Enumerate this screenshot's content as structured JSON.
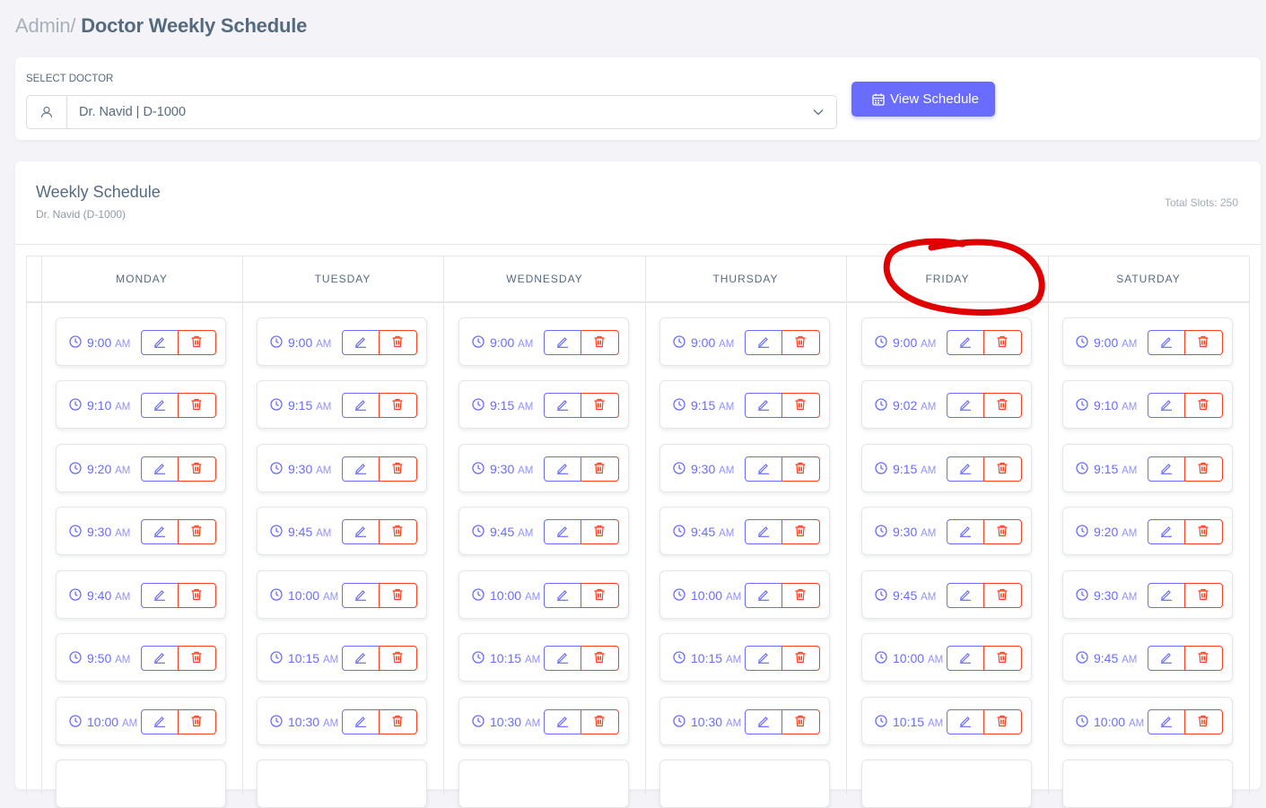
{
  "breadcrumb": {
    "parent": "Admin/",
    "current": "Doctor Weekly Schedule"
  },
  "selector": {
    "label": "SELECT DOCTOR",
    "selected_value": "Dr. Navid | D-1000",
    "icon": "user-icon",
    "button_label": "View Schedule",
    "button_icon": "calendar-icon"
  },
  "schedule": {
    "title": "Weekly Schedule",
    "subtitle": "Dr. Navid (D-1000)",
    "total_slots": "Total Slots: 250",
    "days": [
      {
        "name": "MONDAY",
        "slots": [
          [
            "9:00",
            "AM"
          ],
          [
            "9:10",
            "AM"
          ],
          [
            "9:20",
            "AM"
          ],
          [
            "9:30",
            "AM"
          ],
          [
            "9:40",
            "AM"
          ],
          [
            "9:50",
            "AM"
          ],
          [
            "10:00",
            "AM"
          ]
        ]
      },
      {
        "name": "TUESDAY",
        "slots": [
          [
            "9:00",
            "AM"
          ],
          [
            "9:15",
            "AM"
          ],
          [
            "9:30",
            "AM"
          ],
          [
            "9:45",
            "AM"
          ],
          [
            "10:00",
            "AM"
          ],
          [
            "10:15",
            "AM"
          ],
          [
            "10:30",
            "AM"
          ]
        ]
      },
      {
        "name": "WEDNESDAY",
        "slots": [
          [
            "9:00",
            "AM"
          ],
          [
            "9:15",
            "AM"
          ],
          [
            "9:30",
            "AM"
          ],
          [
            "9:45",
            "AM"
          ],
          [
            "10:00",
            "AM"
          ],
          [
            "10:15",
            "AM"
          ],
          [
            "10:30",
            "AM"
          ]
        ]
      },
      {
        "name": "THURSDAY",
        "slots": [
          [
            "9:00",
            "AM"
          ],
          [
            "9:15",
            "AM"
          ],
          [
            "9:30",
            "AM"
          ],
          [
            "9:45",
            "AM"
          ],
          [
            "10:00",
            "AM"
          ],
          [
            "10:15",
            "AM"
          ],
          [
            "10:30",
            "AM"
          ]
        ]
      },
      {
        "name": "FRIDAY",
        "slots": [
          [
            "9:00",
            "AM"
          ],
          [
            "9:02",
            "AM"
          ],
          [
            "9:15",
            "AM"
          ],
          [
            "9:30",
            "AM"
          ],
          [
            "9:45",
            "AM"
          ],
          [
            "10:00",
            "AM"
          ],
          [
            "10:15",
            "AM"
          ]
        ]
      },
      {
        "name": "SATURDAY",
        "slots": [
          [
            "9:00",
            "AM"
          ],
          [
            "9:10",
            "AM"
          ],
          [
            "9:15",
            "AM"
          ],
          [
            "9:20",
            "AM"
          ],
          [
            "9:30",
            "AM"
          ],
          [
            "9:45",
            "AM"
          ],
          [
            "10:00",
            "AM"
          ]
        ]
      }
    ]
  },
  "colors": {
    "primary": "#696cff",
    "danger": "#ff3e1d",
    "annotation": "#e00000"
  }
}
